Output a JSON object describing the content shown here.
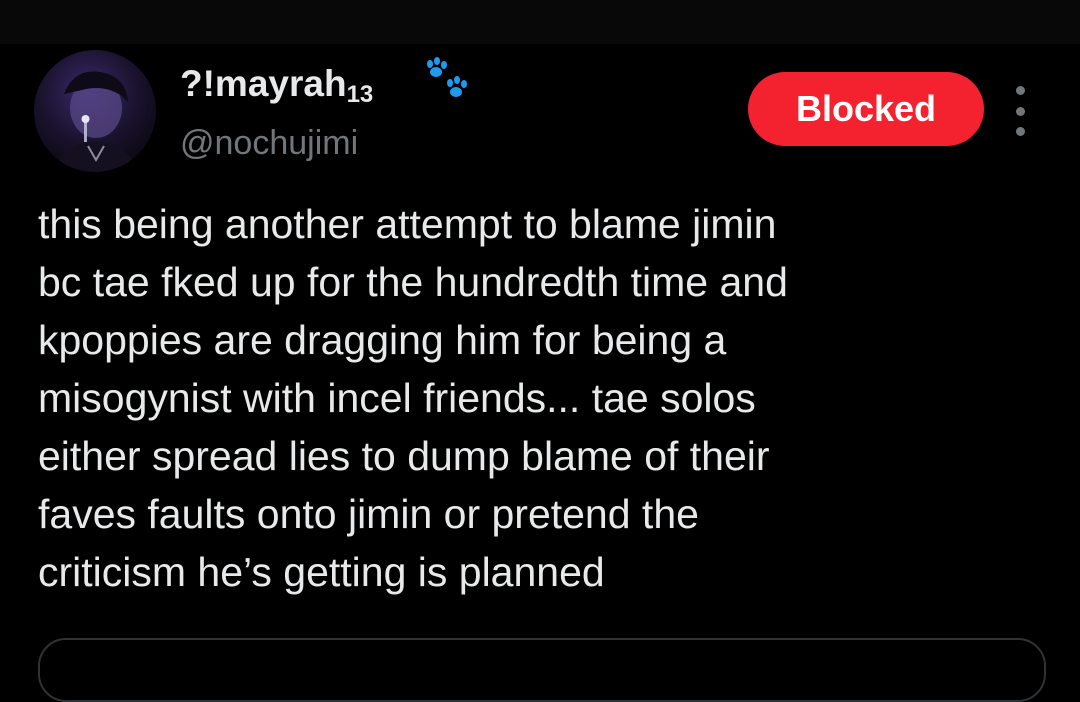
{
  "user": {
    "display_name": "?!mayrah",
    "display_name_subscript": "13",
    "handle": "@nochujimi",
    "badge_icon": "paw-prints-icon"
  },
  "actions": {
    "blocked_label": "Blocked",
    "more_icon": "more-vertical-icon"
  },
  "tweet": {
    "lines": [
      "this being another attempt to blame jimin",
      "bc tae fked up for the hundredth time and",
      "kpoppies are dragging him for being a",
      "misogynist with incel friends... tae solos",
      "either spread lies to dump blame of their",
      "faves faults onto jimin or pretend the",
      "criticism he’s getting is planned"
    ]
  },
  "colors": {
    "background": "#000000",
    "text": "#e7e9ea",
    "secondary": "#71767b",
    "blocked": "#f4212e",
    "paw": "#1d9bf0"
  }
}
